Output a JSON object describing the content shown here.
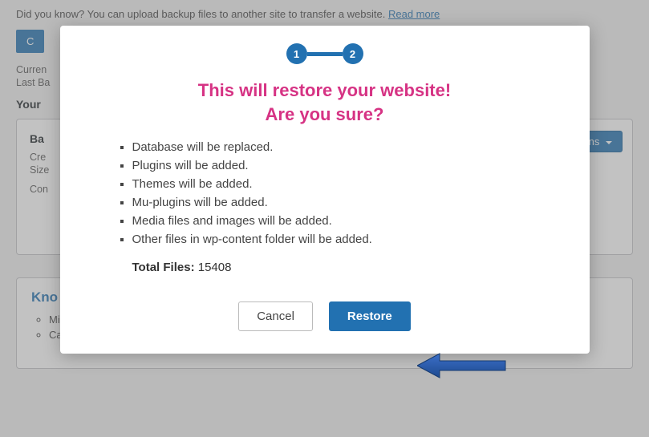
{
  "tip": {
    "prefix": "Did you know? You can upload backup files to another site to transfer a website. ",
    "link": "Read more"
  },
  "create_button": "C",
  "status": {
    "current": "Curren",
    "last": "Last Ba"
  },
  "section_title": "Your",
  "panel": {
    "head": "Ba",
    "created": "Cre",
    "size": "Size",
    "contains": "Con",
    "actions": "Actions"
  },
  "kb": {
    "title": "Kno",
    "items": [
      "Mig",
      "Can not login to staging site"
    ]
  },
  "modal": {
    "step1": "1",
    "step2": "2",
    "title_line1": "This will restore your website!",
    "title_line2": "Are you sure?",
    "bullets": [
      "Database will be replaced.",
      "Plugins will be added.",
      "Themes will be added.",
      "Mu-plugins will be added.",
      "Media files and images will be added.",
      "Other files in wp-content folder will be added."
    ],
    "total_label": "Total Files:",
    "total_value": "15408",
    "cancel": "Cancel",
    "restore": "Restore"
  }
}
